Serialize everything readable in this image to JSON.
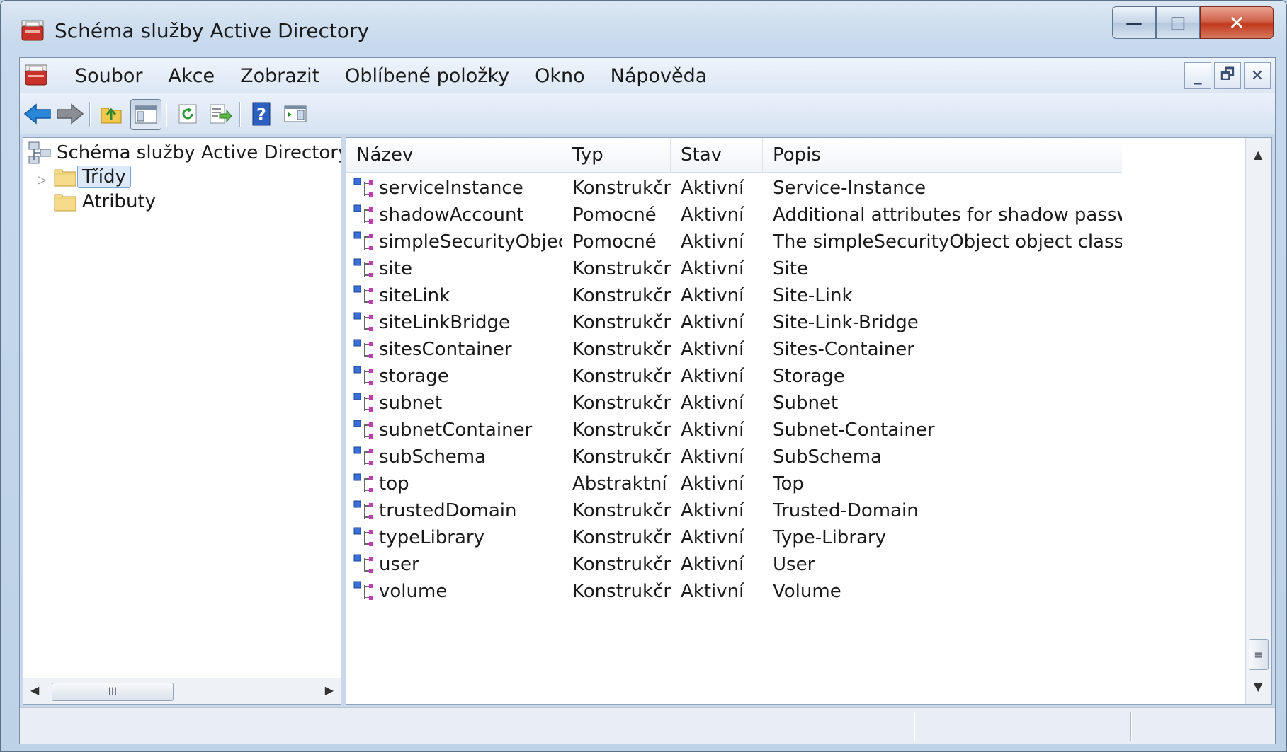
{
  "window": {
    "title": "Schéma služby Active Directory"
  },
  "caption_buttons": {
    "minimize": "—",
    "restore": "□",
    "close": "✕"
  },
  "menubar": {
    "items": [
      "Soubor",
      "Akce",
      "Zobrazit",
      "Oblíbené položky",
      "Okno",
      "Nápověda"
    ],
    "mdi_minimize": "_",
    "mdi_restore": "🗗",
    "mdi_close": "✕"
  },
  "tree": {
    "root": "Schéma služby Active Directory",
    "children": [
      {
        "label": "Třídy",
        "selected": true,
        "expandable": true
      },
      {
        "label": "Atributy",
        "selected": false,
        "expandable": false
      }
    ]
  },
  "list": {
    "columns": [
      "Název",
      "Typ",
      "Stav",
      "Popis"
    ],
    "rows": [
      {
        "name": "serviceInstance",
        "type": "Konstrukční",
        "state": "Aktivní",
        "desc": "Service-Instance"
      },
      {
        "name": "shadowAccount",
        "type": "Pomocné",
        "state": "Aktivní",
        "desc": "Additional attributes for shadow passwords"
      },
      {
        "name": "simpleSecurityObject",
        "type": "Pomocné",
        "state": "Aktivní",
        "desc": "The simpleSecurityObject object class is used ..."
      },
      {
        "name": "site",
        "type": "Konstrukční",
        "state": "Aktivní",
        "desc": "Site"
      },
      {
        "name": "siteLink",
        "type": "Konstrukční",
        "state": "Aktivní",
        "desc": "Site-Link"
      },
      {
        "name": "siteLinkBridge",
        "type": "Konstrukční",
        "state": "Aktivní",
        "desc": "Site-Link-Bridge"
      },
      {
        "name": "sitesContainer",
        "type": "Konstrukční",
        "state": "Aktivní",
        "desc": "Sites-Container"
      },
      {
        "name": "storage",
        "type": "Konstrukční",
        "state": "Aktivní",
        "desc": "Storage"
      },
      {
        "name": "subnet",
        "type": "Konstrukční",
        "state": "Aktivní",
        "desc": "Subnet"
      },
      {
        "name": "subnetContainer",
        "type": "Konstrukční",
        "state": "Aktivní",
        "desc": "Subnet-Container"
      },
      {
        "name": "subSchema",
        "type": "Konstrukční",
        "state": "Aktivní",
        "desc": "SubSchema"
      },
      {
        "name": "top",
        "type": "Abstraktní",
        "state": "Aktivní",
        "desc": "Top"
      },
      {
        "name": "trustedDomain",
        "type": "Konstrukční",
        "state": "Aktivní",
        "desc": "Trusted-Domain"
      },
      {
        "name": "typeLibrary",
        "type": "Konstrukční",
        "state": "Aktivní",
        "desc": "Type-Library"
      },
      {
        "name": "user",
        "type": "Konstrukční",
        "state": "Aktivní",
        "desc": "User"
      },
      {
        "name": "volume",
        "type": "Konstrukční",
        "state": "Aktivní",
        "desc": "Volume"
      }
    ]
  },
  "scrollbar_grip": "III",
  "vscroll_grip": "≡"
}
